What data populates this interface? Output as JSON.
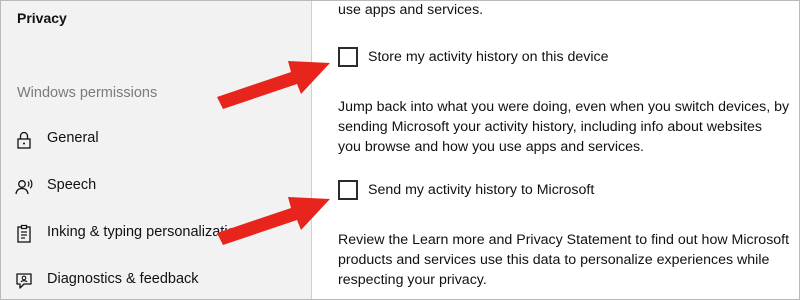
{
  "sidebar": {
    "title": "Privacy",
    "section_label": "Windows permissions",
    "items": [
      {
        "label": "General",
        "icon": "lock-icon"
      },
      {
        "label": "Speech",
        "icon": "speech-icon"
      },
      {
        "label": "Inking & typing personalizatio",
        "icon": "inking-clipboard-icon"
      },
      {
        "label": "Diagnostics & feedback",
        "icon": "feedback-icon"
      }
    ]
  },
  "main": {
    "top_text": "use apps and services.",
    "checkbox1": {
      "label": "Store my activity history on this device",
      "checked": false
    },
    "paragraph1": [
      "Jump back into what you were doing, even when you switch devices, by",
      "sending Microsoft your activity history, including info about websites",
      "you browse and how you use apps and services."
    ],
    "checkbox2": {
      "label": "Send my activity history to Microsoft",
      "checked": false
    },
    "paragraph2": [
      "Review the Learn more and Privacy Statement to find out how Microsoft",
      "products and services use this data to personalize experiences while",
      "respecting your privacy."
    ]
  },
  "colors": {
    "arrow": "#e8251d",
    "sidebar_bg": "#f2f2f2",
    "text": "#111111",
    "muted": "#7a7a7a"
  }
}
